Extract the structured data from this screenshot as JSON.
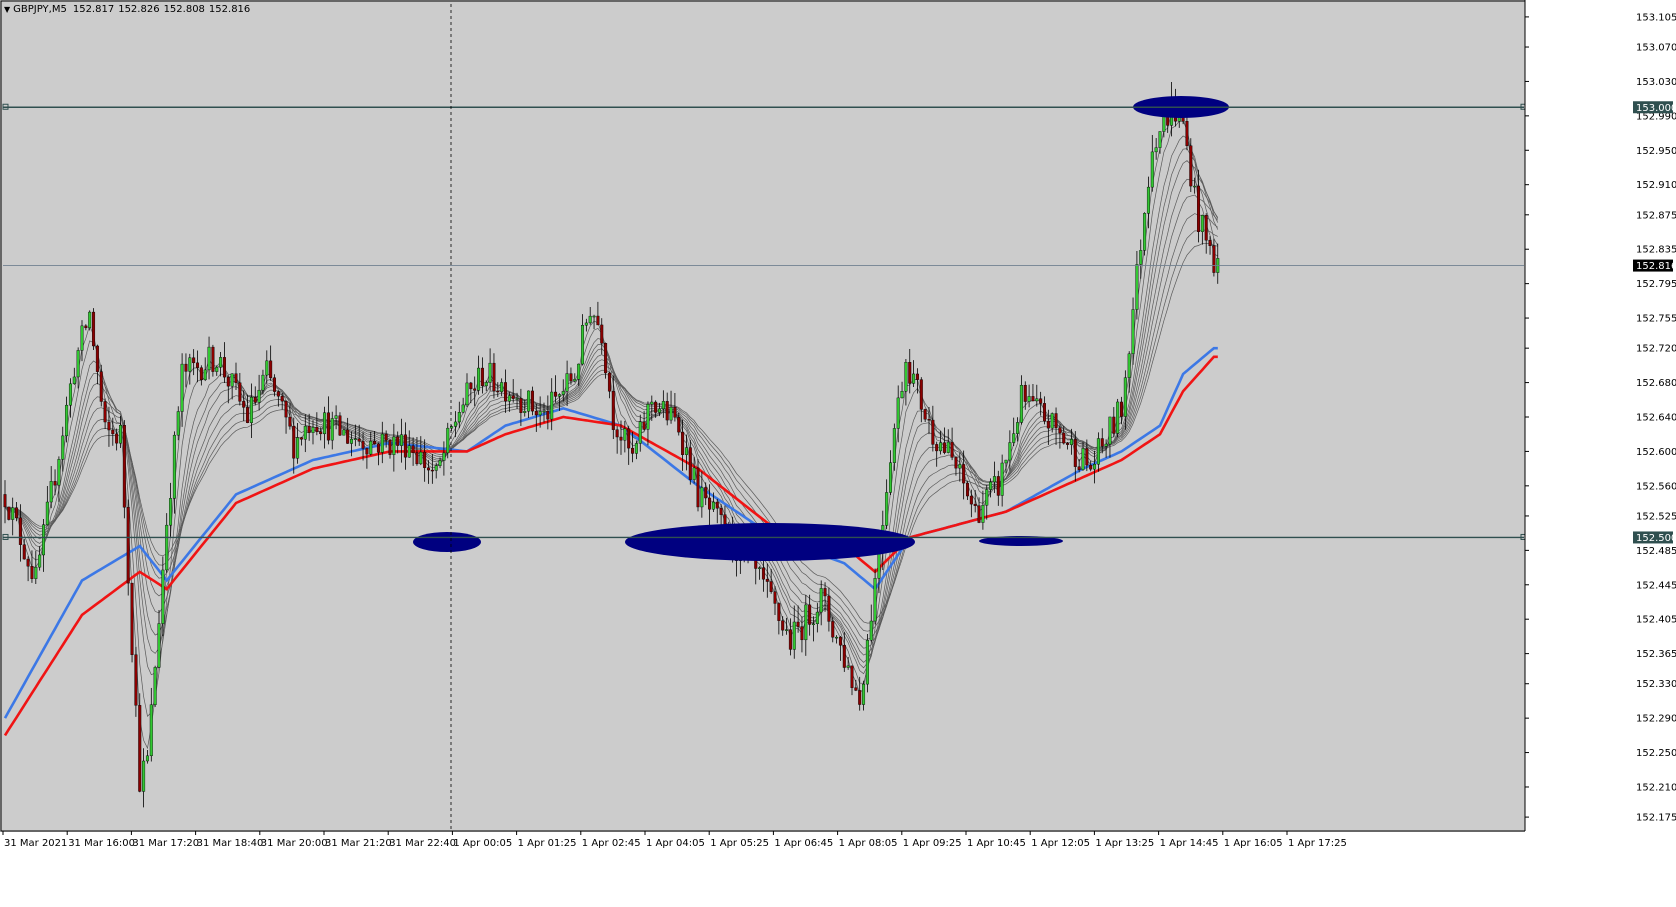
{
  "header": {
    "symbol": "GBPJPY,M5",
    "open": "152.817",
    "high": "152.826",
    "low": "152.808",
    "close": "152.816"
  },
  "chart_data": {
    "type": "candlestick",
    "symbol": "GBPJPY",
    "timeframe": "M5",
    "ylim": [
      152.16,
      153.12
    ],
    "y_ticks": [
      "153.105",
      "153.070",
      "153.030",
      "152.990",
      "152.950",
      "152.910",
      "152.875",
      "152.835",
      "152.795",
      "152.755",
      "152.720",
      "152.680",
      "152.640",
      "152.600",
      "152.560",
      "152.525",
      "152.485",
      "152.445",
      "152.405",
      "152.365",
      "152.330",
      "152.290",
      "152.250",
      "152.210",
      "152.175"
    ],
    "x_ticks": [
      "31 Mar 2021",
      "31 Mar 16:00",
      "31 Mar 17:20",
      "31 Mar 18:40",
      "31 Mar 20:00",
      "31 Mar 21:20",
      "31 Mar 22:40",
      "1 Apr 00:05",
      "1 Apr 01:25",
      "1 Apr 02:45",
      "1 Apr 04:05",
      "1 Apr 05:25",
      "1 Apr 06:45",
      "1 Apr 08:05",
      "1 Apr 09:25",
      "1 Apr 10:45",
      "1 Apr 12:05",
      "1 Apr 13:25",
      "1 Apr 14:45",
      "1 Apr 16:05",
      "1 Apr 17:25"
    ],
    "horizontal_lines": [
      {
        "price": 153.0,
        "label": "153.000",
        "color": "#2f4f4f"
      },
      {
        "price": 152.5,
        "label": "152.500",
        "color": "#2f4f4f"
      }
    ],
    "bid_line": {
      "price": 152.816,
      "label": "152.816",
      "color": "#708090"
    },
    "vertical_separators": [
      "1 Apr 00:05"
    ],
    "zones": [
      {
        "x": "1 Apr 00:05",
        "price": 152.5
      },
      {
        "x": "1 Apr 04:05 - 1 Apr 10:45",
        "price": 152.5
      },
      {
        "x": "1 Apr 12:05 - 1 Apr 13:25",
        "price": 152.5
      },
      {
        "x": "1 Apr 16:05 - 1 Apr 17:25",
        "price": 153.0
      }
    ],
    "path": [
      [
        0,
        152.55
      ],
      [
        8,
        152.45
      ],
      [
        18,
        152.7
      ],
      [
        22,
        152.76
      ],
      [
        26,
        152.62
      ],
      [
        30,
        152.62
      ],
      [
        35,
        152.22
      ],
      [
        37,
        152.24
      ],
      [
        42,
        152.52
      ],
      [
        46,
        152.69
      ],
      [
        55,
        152.71
      ],
      [
        63,
        152.64
      ],
      [
        68,
        152.69
      ],
      [
        75,
        152.61
      ],
      [
        80,
        152.64
      ],
      [
        88,
        152.62
      ],
      [
        96,
        152.61
      ],
      [
        105,
        152.61
      ],
      [
        112,
        152.57
      ],
      [
        118,
        152.65
      ],
      [
        124,
        152.69
      ],
      [
        132,
        152.67
      ],
      [
        140,
        152.64
      ],
      [
        148,
        152.69
      ],
      [
        152,
        152.77
      ],
      [
        155,
        152.74
      ],
      [
        158,
        152.64
      ],
      [
        163,
        152.59
      ],
      [
        168,
        152.66
      ],
      [
        175,
        152.63
      ],
      [
        180,
        152.55
      ],
      [
        188,
        152.5
      ],
      [
        196,
        152.45
      ],
      [
        204,
        152.38
      ],
      [
        212,
        152.43
      ],
      [
        218,
        152.36
      ],
      [
        222,
        152.31
      ],
      [
        226,
        152.45
      ],
      [
        230,
        152.6
      ],
      [
        234,
        152.71
      ],
      [
        240,
        152.63
      ],
      [
        246,
        152.59
      ],
      [
        252,
        152.53
      ],
      [
        258,
        152.56
      ],
      [
        264,
        152.66
      ],
      [
        270,
        152.64
      ],
      [
        276,
        152.61
      ],
      [
        282,
        152.58
      ],
      [
        290,
        152.65
      ],
      [
        298,
        152.96
      ],
      [
        303,
        153.0
      ],
      [
        306,
        152.98
      ],
      [
        310,
        152.87
      ],
      [
        314,
        152.82
      ]
    ],
    "ma_series": [
      {
        "name": "",
        "color": "#3c78e6",
        "values": [
          [
            0,
            152.29
          ],
          [
            20,
            152.45
          ],
          [
            35,
            152.49
          ],
          [
            42,
            152.45
          ],
          [
            60,
            152.55
          ],
          [
            80,
            152.59
          ],
          [
            100,
            152.61
          ],
          [
            120,
            152.6
          ],
          [
            130,
            152.63
          ],
          [
            145,
            152.65
          ],
          [
            160,
            152.63
          ],
          [
            180,
            152.56
          ],
          [
            200,
            152.5
          ],
          [
            218,
            152.47
          ],
          [
            226,
            152.44
          ],
          [
            235,
            152.5
          ],
          [
            260,
            152.53
          ],
          [
            280,
            152.58
          ],
          [
            290,
            152.6
          ],
          [
            300,
            152.63
          ],
          [
            306,
            152.69
          ],
          [
            314,
            152.72
          ]
        ]
      },
      {
        "name": "",
        "color": "#f01414",
        "values": [
          [
            0,
            152.27
          ],
          [
            20,
            152.41
          ],
          [
            35,
            152.46
          ],
          [
            42,
            152.44
          ],
          [
            60,
            152.54
          ],
          [
            80,
            152.58
          ],
          [
            100,
            152.6
          ],
          [
            120,
            152.6
          ],
          [
            130,
            152.62
          ],
          [
            145,
            152.64
          ],
          [
            160,
            152.63
          ],
          [
            180,
            152.58
          ],
          [
            200,
            152.51
          ],
          [
            218,
            152.49
          ],
          [
            226,
            152.46
          ],
          [
            235,
            152.5
          ],
          [
            260,
            152.53
          ],
          [
            280,
            152.57
          ],
          [
            290,
            152.59
          ],
          [
            300,
            152.62
          ],
          [
            306,
            152.67
          ],
          [
            314,
            152.71
          ]
        ]
      }
    ],
    "colors": {
      "background": "#cccccc",
      "grid": "#000000",
      "bull": "#32c832",
      "bear": "#8b0000",
      "zone": "#000080"
    }
  }
}
